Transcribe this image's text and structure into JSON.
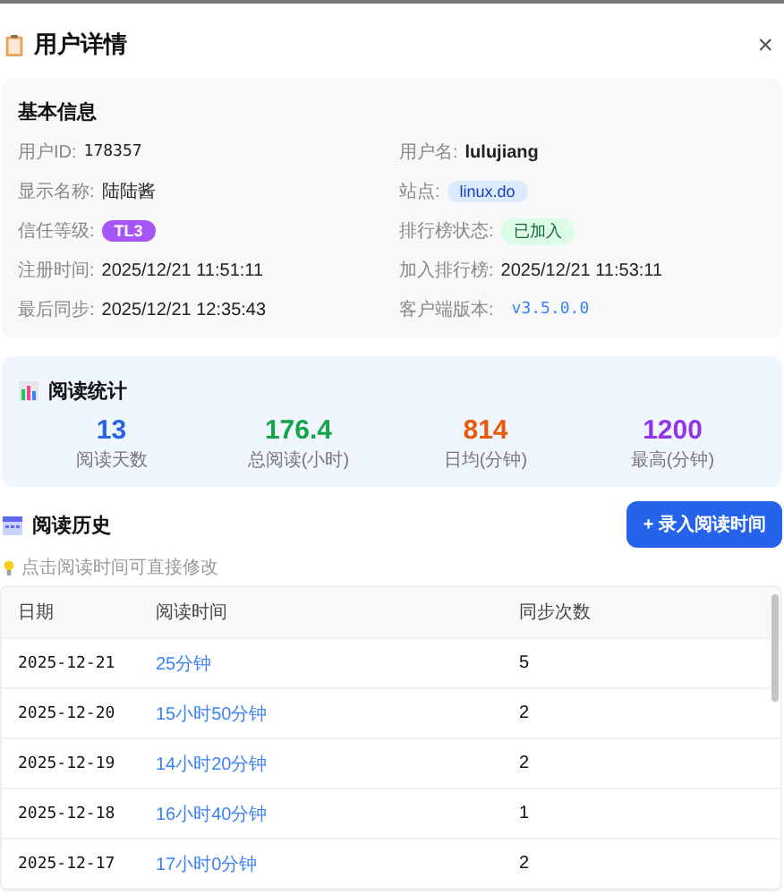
{
  "dialog": {
    "title": "用户详情",
    "close": "×"
  },
  "basic_info": {
    "title": "基本信息",
    "fields": [
      {
        "label": "用户ID:",
        "value": "178357",
        "kind": "mono"
      },
      {
        "label": "用户名:",
        "value": "lulujiang",
        "kind": "bold"
      },
      {
        "label": "显示名称:",
        "value": "陆陆酱",
        "kind": "text"
      },
      {
        "label": "站点:",
        "value": "linux.do",
        "kind": "site-tag"
      },
      {
        "label": "信任等级:",
        "value": "TL3",
        "kind": "level-tag"
      },
      {
        "label": "排行榜状态:",
        "value": "已加入",
        "kind": "status-tag"
      },
      {
        "label": "注册时间:",
        "value": "2025/12/21 11:51:11",
        "kind": "text"
      },
      {
        "label": "加入排行榜:",
        "value": "2025/12/21 11:53:11",
        "kind": "text"
      },
      {
        "label": "最后同步:",
        "value": "2025/12/21 12:35:43",
        "kind": "text"
      },
      {
        "label": "客户端版本:",
        "value": "v3.5.0.0",
        "kind": "code"
      }
    ]
  },
  "reading_stats": {
    "title": "阅读统计",
    "items": [
      {
        "value": "13",
        "label": "阅读天数",
        "color": "#2563eb"
      },
      {
        "value": "176.4",
        "label": "总阅读(小时)",
        "color": "#16a34a"
      },
      {
        "value": "814",
        "label": "日均(分钟)",
        "color": "#ea580c"
      },
      {
        "value": "1200",
        "label": "最高(分钟)",
        "color": "#9333ea"
      }
    ]
  },
  "reading_history": {
    "title": "阅读历史",
    "add_button": "+ 录入阅读时间",
    "hint": "点击阅读时间可直接修改",
    "columns": [
      "日期",
      "阅读时间",
      "同步次数"
    ],
    "rows": [
      {
        "date": "2025-12-21",
        "time": "25分钟",
        "syncs": "5"
      },
      {
        "date": "2025-12-20",
        "time": "15小时50分钟",
        "syncs": "2"
      },
      {
        "date": "2025-12-19",
        "time": "14小时20分钟",
        "syncs": "2"
      },
      {
        "date": "2025-12-18",
        "time": "16小时40分钟",
        "syncs": "1"
      },
      {
        "date": "2025-12-17",
        "time": "17小时0分钟",
        "syncs": "2"
      }
    ]
  }
}
